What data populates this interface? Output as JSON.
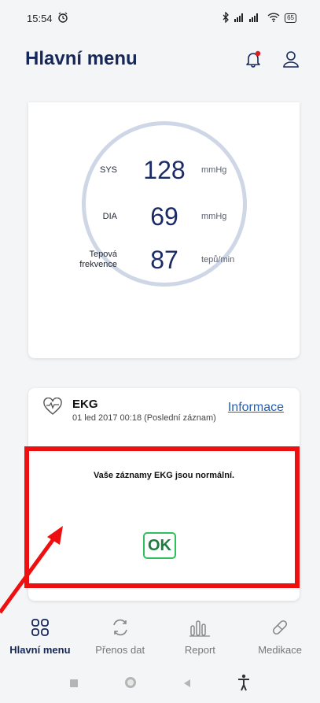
{
  "status": {
    "time": "15:54",
    "battery": "65"
  },
  "header": {
    "title": "Hlavní menu"
  },
  "bp": {
    "sys_label": "SYS",
    "sys_value": "128",
    "sys_unit": "mmHg",
    "dia_label": "DIA",
    "dia_value": "69",
    "dia_unit": "mmHg",
    "pulse_label_1": "Tepová",
    "pulse_label_2": "frekvence",
    "pulse_value": "87",
    "pulse_unit": "tepů/min"
  },
  "ekg": {
    "title": "EKG",
    "subtitle": "01 led 2017 00:18 (Poslední záznam)",
    "info_link": "Informace"
  },
  "dialog": {
    "message": "Vaše záznamy EKG jsou normální.",
    "ok_label": "OK"
  },
  "nav": {
    "items": [
      {
        "label": "Hlavní menu",
        "icon": "grid-icon"
      },
      {
        "label": "Přenos dat",
        "icon": "sync-icon"
      },
      {
        "label": "Report",
        "icon": "bars-icon"
      },
      {
        "label": "Medikace",
        "icon": "pill-icon"
      }
    ]
  },
  "colors": {
    "accent": "#16275a",
    "ok_green": "#2ec05a",
    "highlight": "#ee1010",
    "link": "#1f5fb8"
  }
}
